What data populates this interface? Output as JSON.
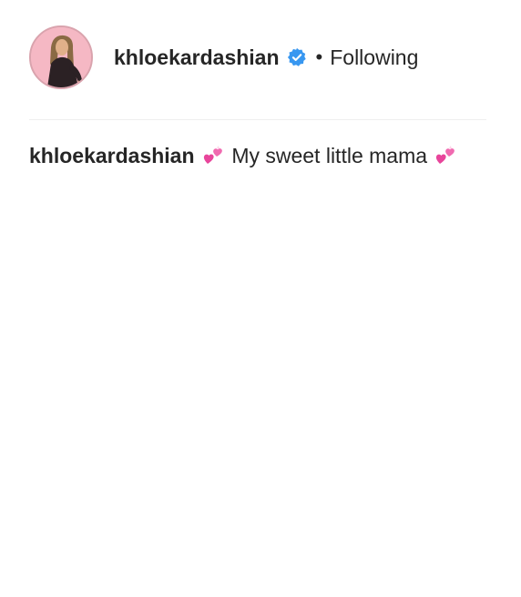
{
  "post": {
    "username": "khloekardashian",
    "separator": "•",
    "follow_status": "Following",
    "verified_icon": "verified-badge-icon",
    "verified_color": "#3897f0"
  },
  "caption": {
    "username": "khloekardashian",
    "text": "My sweet little mama",
    "emoji_icon": "two-hearts-emoji",
    "emoji_color": "#e8459b"
  },
  "colors": {
    "avatar_bg": "#f5b8c4",
    "text": "#262626",
    "divider": "#efefef"
  }
}
